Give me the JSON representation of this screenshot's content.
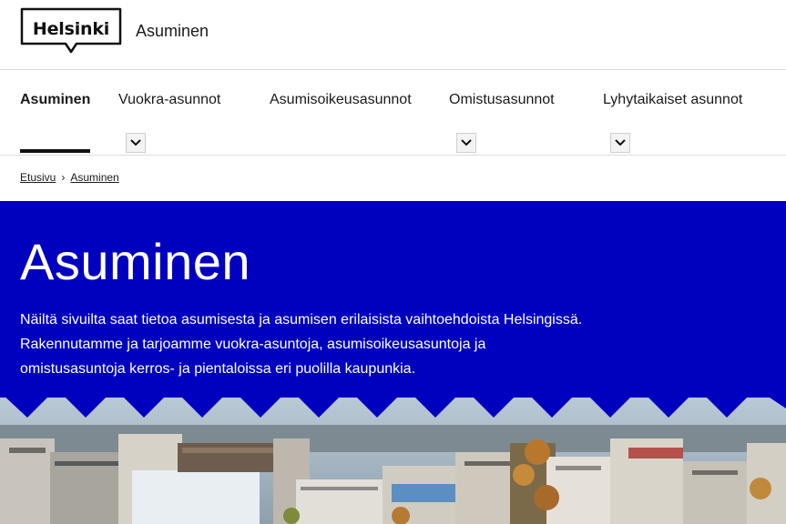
{
  "header": {
    "logo_text": "Helsinki",
    "site_name": "Asuminen"
  },
  "nav": {
    "items": [
      {
        "label": "Asuminen",
        "active": true,
        "has_dropdown": false
      },
      {
        "label": "Vuokra-asunnot",
        "active": false,
        "has_dropdown": true
      },
      {
        "label": "Asumisoikeusasunnot",
        "active": false,
        "has_dropdown": false
      },
      {
        "label": "Omistusasunnot",
        "active": false,
        "has_dropdown": true
      },
      {
        "label": "Lyhytaikaiset asunnot",
        "active": false,
        "has_dropdown": true
      }
    ],
    "dropdown_icon": "chevron-down-icon"
  },
  "breadcrumb": {
    "items": [
      "Etusivu",
      "Asuminen"
    ],
    "separator": "›"
  },
  "hero": {
    "title": "Asuminen",
    "lines": [
      "Näiltä sivuilta saat tietoa asumisesta ja asumisen erilaisista vaihtoehdoista Helsingissä.",
      "Rakennutamme ja tarjoamme vuokra-asuntoja, asumisoikeusasuntoja ja",
      "omistusasuntoja kerros- ja pientaloissa eri puolilla kaupunkia."
    ],
    "background_color": "#0000bf",
    "image_description_icon": "city-aerial-photo"
  },
  "colors": {
    "brand_blue": "#0000bf",
    "text": "#1a1a1a",
    "border": "#dcdcdc"
  }
}
